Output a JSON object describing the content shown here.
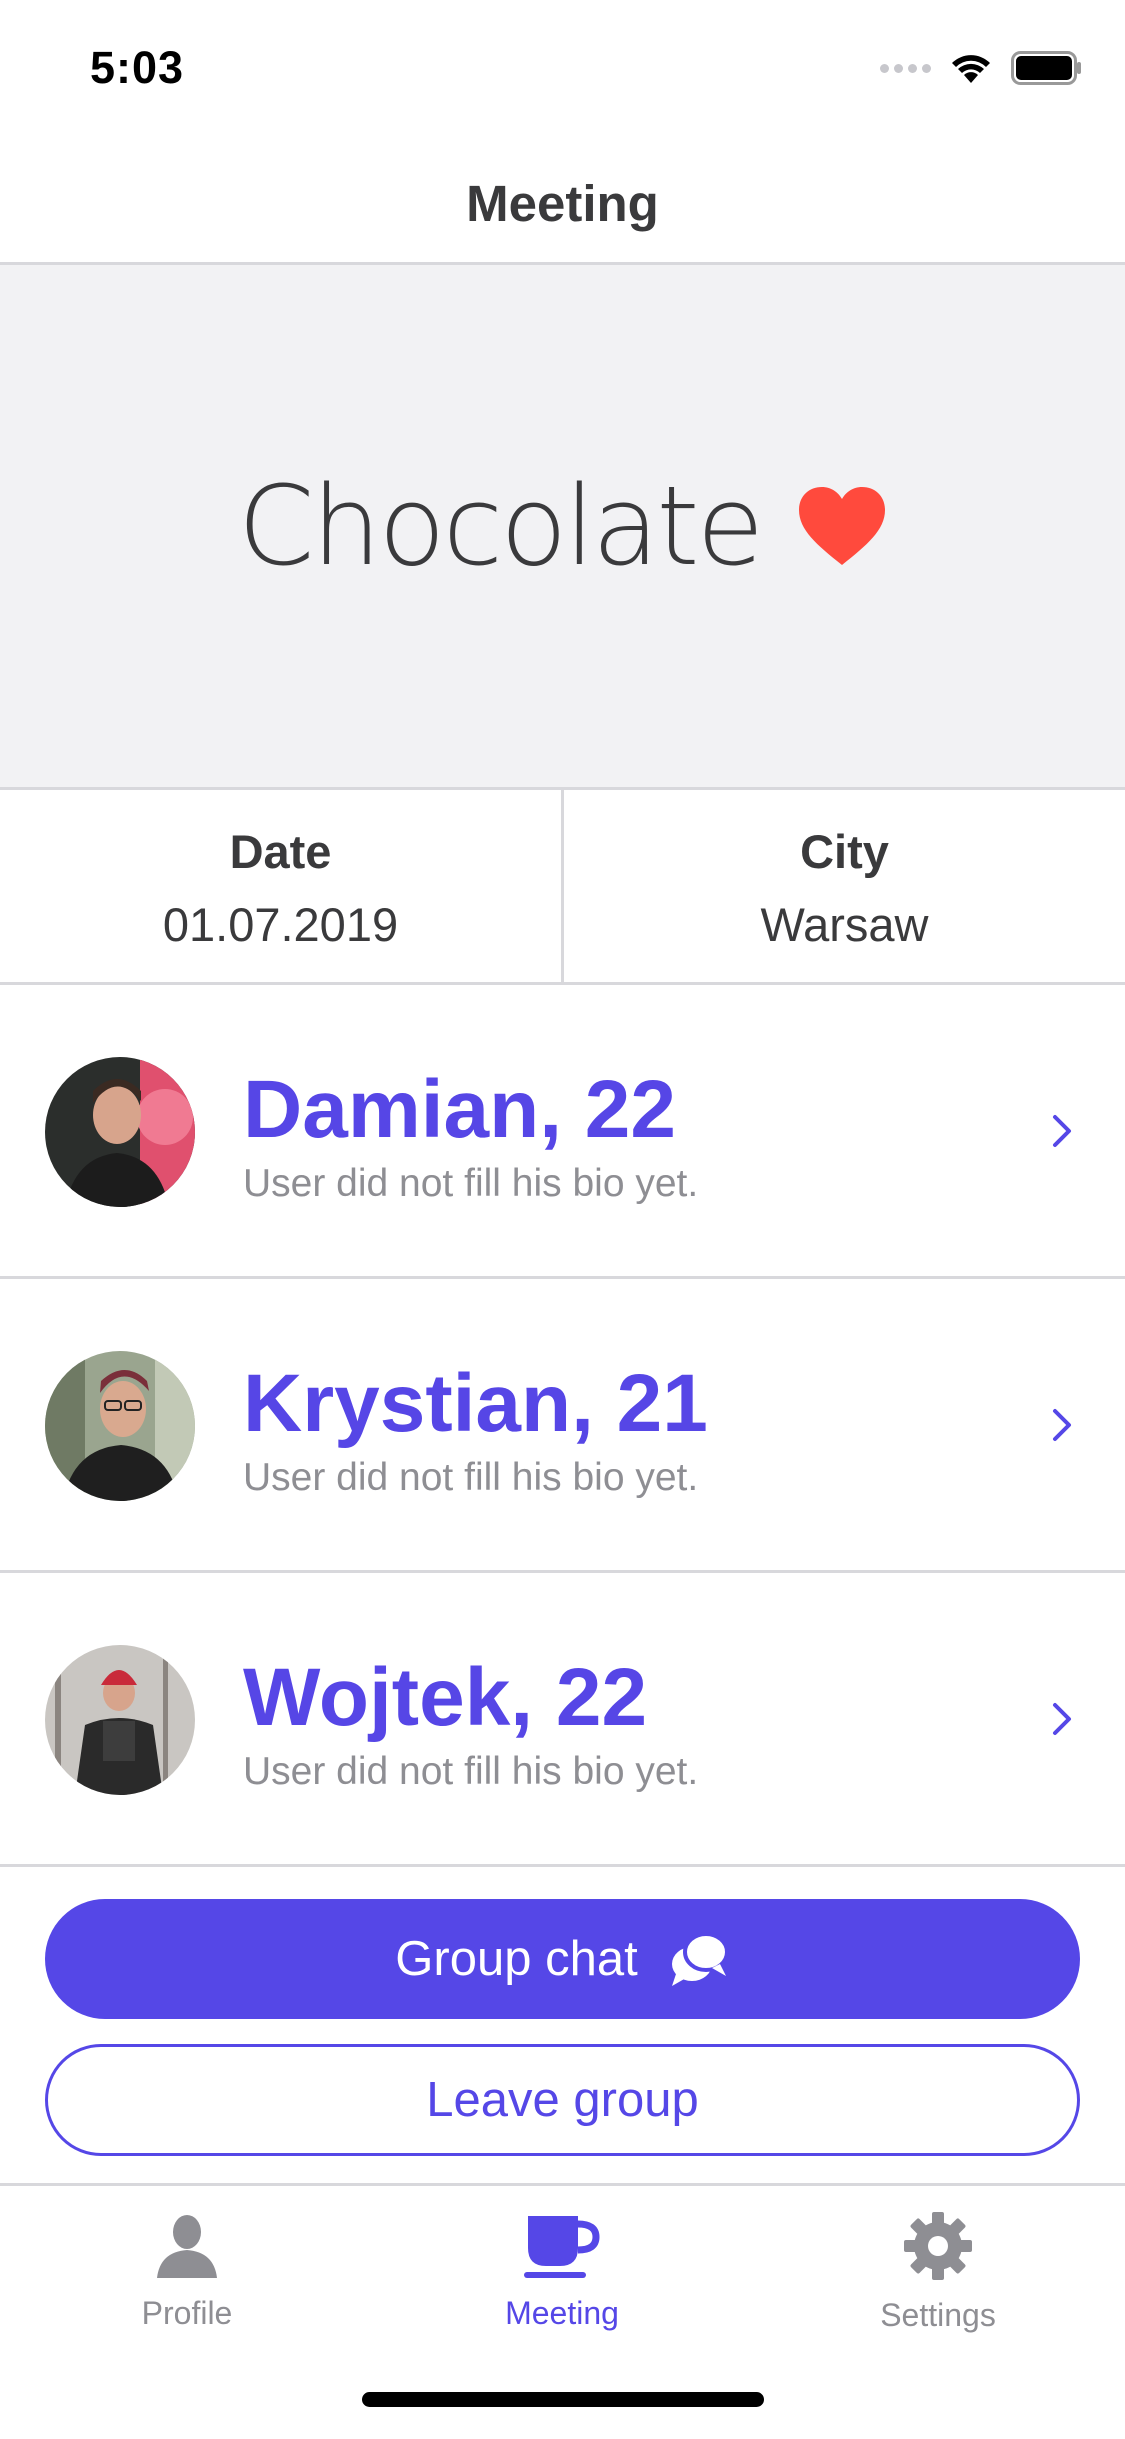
{
  "status_bar": {
    "time": "5:03"
  },
  "nav": {
    "title": "Meeting"
  },
  "hero": {
    "title": "Chocolate",
    "icon": "heart-icon",
    "icon_color": "#ff4a3d"
  },
  "info": {
    "date_label": "Date",
    "date_value": "01.07.2019",
    "city_label": "City",
    "city_value": "Warsaw"
  },
  "members": [
    {
      "name": "Damian, 22",
      "bio": "User did not fill his bio yet."
    },
    {
      "name": "Krystian, 21",
      "bio": "User did not fill his bio yet."
    },
    {
      "name": "Wojtek, 22",
      "bio": "User did not fill his bio yet."
    }
  ],
  "actions": {
    "group_chat_label": "Group chat",
    "leave_group_label": "Leave group"
  },
  "tabs": [
    {
      "label": "Profile",
      "icon": "person-icon",
      "active": false
    },
    {
      "label": "Meeting",
      "icon": "coffee-cup-icon",
      "active": true
    },
    {
      "label": "Settings",
      "icon": "gear-icon",
      "active": false
    }
  ],
  "colors": {
    "accent": "#5547e7",
    "divider": "#d8d8dc",
    "hero_bg": "#f2f2f4",
    "muted": "#8e8e93"
  }
}
